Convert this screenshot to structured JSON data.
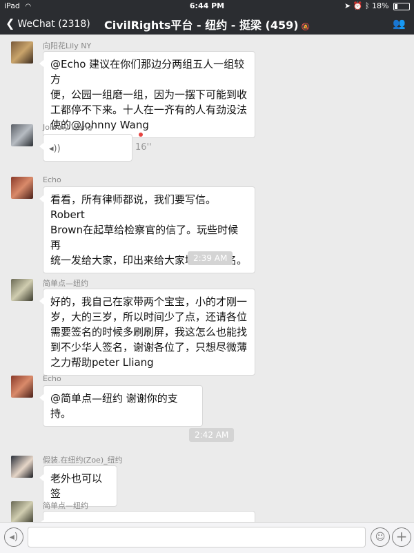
{
  "status_bar": {
    "carrier": "iPad",
    "time": "6:44 PM",
    "battery_text": "18%",
    "battery_level": 0.18
  },
  "nav": {
    "back_label": "WeChat (2318)",
    "title": "CivilRights平台 - 纽约 - 挺梁 (459)"
  },
  "messages": [
    {
      "sender": "向阳花Lily NY",
      "text": "@Echo 建议在你们那边分两组五人一组较方\n便，公园一组磨一组，因为一摆下可能到收\n工都停不下来。十人在一齐有的人有劲没法\n使的@Johnny Wang"
    },
    {
      "sender": "Johnny Wang",
      "voice_duration": "16''"
    },
    {
      "sender": "Echo",
      "text": "看看，所有律师都说，我们要写信。Robert\nBrown在起草给检察官的信了。玩些时候再\n统一发给大家，印出来给大家填写、签名。"
    },
    {
      "sender": "简单点—纽约",
      "text": "好的，我自己在家带两个宝宝，小的才刚一\n岁，大的三岁，所以时间少了点，还请各位\n需要签名的时候多刷刷屏，我这怎么也能找\n到不少华人签名，谢谢各位了，只想尽微薄\n之力帮助peter Lliang"
    },
    {
      "sender": "Echo",
      "text": "@简单点—纽约  谢谢你的支持。"
    },
    {
      "sender": "假装.在纽约(Zoe)_纽约",
      "text": "老外也可以签"
    },
    {
      "sender": "简单点—纽约",
      "text": ""
    }
  ],
  "timestamps": [
    "2:39 AM",
    "2:42 AM"
  ],
  "input": {
    "value": "",
    "placeholder": ""
  },
  "icons": {
    "back": "chevron-left-icon",
    "members": "members-icon",
    "voice": "voice-icon",
    "emoji": "emoji-icon",
    "plus": "plus-icon"
  },
  "colors": {
    "bar": "#2b2d31",
    "background": "#ebebeb",
    "unread": "#e64340"
  }
}
